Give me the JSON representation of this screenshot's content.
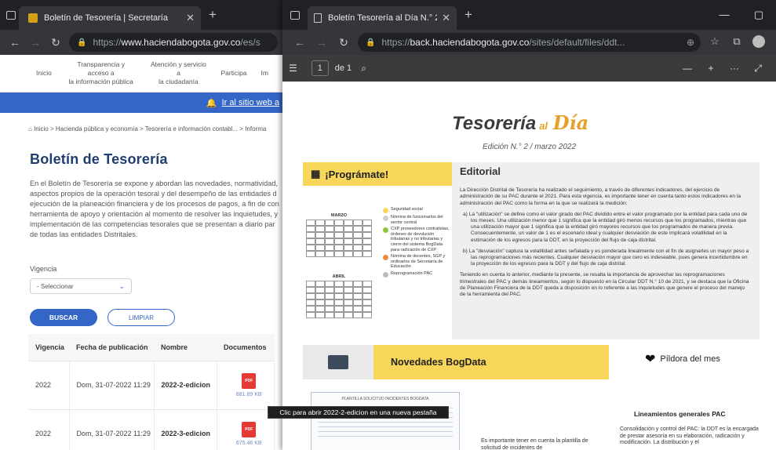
{
  "left": {
    "tab_title": "Boletín de Tesorería | Secretaría",
    "url_prefix": "https://",
    "url_domain": "www.haciendabogota.gov.co",
    "url_rest": "/es/s",
    "nav": [
      "Inicio",
      "Transparencia y acceso a\nla información pública",
      "Atención y servicio a\nla ciudadanía",
      "Participa",
      "Im"
    ],
    "banner_link": "Ir al sitio web a",
    "breadcrumb": "Inicio > Hacienda pública y economía > Tesorería e información contabl... > Informa",
    "title": "Boletín de Tesorería",
    "description": [
      "En el Boletín de Tesorería se expone y abordan las  novedades, normatividad,",
      "aspectos propios de la operación tesoral y del desempeño de las entidades d",
      "ejecución de la planeación financiera y de los procesos de pagos, a fin de con",
      "herramienta de apoyo y orientación al momento de resolver las inquietudes, y",
      "implementación de las competencias tesorales que se  presentan a diario par",
      "de todas las entidades Distritales."
    ],
    "vigencia_label": "Vigencia",
    "vigencia_select": "- Seleccionar",
    "btn_buscar": "BUSCAR",
    "btn_limpiar": "LIMPIAR",
    "table": {
      "headers": [
        "Vigencia",
        "Fecha de publicación",
        "Nombre",
        "Documentos"
      ],
      "rows": [
        {
          "vigencia": "2022",
          "fecha": "Dom, 31-07-2022 11:29",
          "nombre": "2022-2-edicion",
          "size": "881.89 KB"
        },
        {
          "vigencia": "2022",
          "fecha": "Dom, 31-07-2022 11:29",
          "nombre": "2022-3-edicion",
          "size": "675.46 KB"
        }
      ]
    }
  },
  "right": {
    "tab_title": "Boletín Tesorería al Día N.° 2_20",
    "url_prefix": "https://",
    "url_domain": "back.haciendabogota.gov.co",
    "url_rest": "/sites/default/files/ddt...",
    "page_num": "1",
    "page_of": "de 1",
    "pdf": {
      "brand_main": "Tesorería",
      "brand_al": "al",
      "brand_dia": "Día",
      "edicion": "Edición N.° 2 / marzo 2022",
      "programate": "¡Prográmate!",
      "editorial_title": "Editorial",
      "editorial_p1": "La Dirección Distrital de Tesorería ha realizado el seguimiento, a través de diferentes indicadores, del ejercicio de administración de su PAC durante el 2021. Para esta vigencia, es importante tener en cuenta tanto estos indicadores en la administración del PAC como la forma en la que se realizará la medición:",
      "editorial_a": "a) La \"utilización\" se define como el valor girado del PAC dividido entre el valor programado por la entidad para cada uno de los meses. Una utilización menor que 1 significa que la entidad giró menos recursos que los programados, mientras que una utilización mayor que 1 significa que la entidad giró mayores recursos que los programados de manera previa. Consecuentemente, un valor de 1 es el escenario ideal y cualquier desviación de este implicará volatilidad en la estimación de los egresos para la DDT, en la proyección del flujo de caja distrital.",
      "editorial_b": "b) La \"desviación\" captura la volatilidad antes señalada y es ponderada linealmente con el fin de asignarles un mayor peso a las reprogramaciones más recientes. Cualquier desviación mayor que cero es indeseable, pues genera incertidumbre en la proyección de los egresos para la DDT y del flujo de caja distrital.",
      "editorial_p2": "Teniendo en cuenta lo anterior, mediante la presente, se resalta la importancia de aprovechar las reprogramaciones trimestrales del PAC y demás lineamientos, según lo dispuesto en la Circular DDT N.° 10 de 2021, y se destaca que la Oficina de Planeación Financiera de la DDT queda a disposición en lo referente a las inquietudes que genere el proceso del manejo de la herramienta del PAC.",
      "cal_marzo": "MARZO",
      "cal_abril": "ABRIL",
      "legend": [
        {
          "text": "Seguridad social",
          "color": "#f7d65a"
        },
        {
          "text": "Nómina de funcionarios del sector central",
          "color": "#cfcfcf"
        },
        {
          "text": "CXP proveedores contratistas, órdenes de devolución tributarias y no tributarias y cierre del sistema BogData para radicación de CXP",
          "color": "#8cc63f"
        },
        {
          "text": "Nómina de docentes, SGP y ordinarios de Secretaría de Educación",
          "color": "#f08a3e"
        },
        {
          "text": "Reprogramación PAC",
          "color": "#bdbdbd"
        }
      ],
      "novedades": "Novedades BogData",
      "pildora": "Píldora del mes",
      "lineamientos": "Lineamientos generales PAC",
      "consolidacion": "Consolidación y control del PAC: la DDT es la encargada de prestar asesoría en su elaboración, radicación y modificación. La distribución y el",
      "plantilla": "PLANTILLA SOLICITUD INCIDENTES BOGDATA",
      "es_importante": "Es importante tener en cuenta la plantilla de solicitud de incidentes de"
    }
  },
  "tooltip": "Clic para abrir 2022-2-edicion en una nueva pestaña",
  "colors": {
    "accent_blue": "#3466c7",
    "yellow": "#f7d65a",
    "orange": "#e7a027"
  }
}
